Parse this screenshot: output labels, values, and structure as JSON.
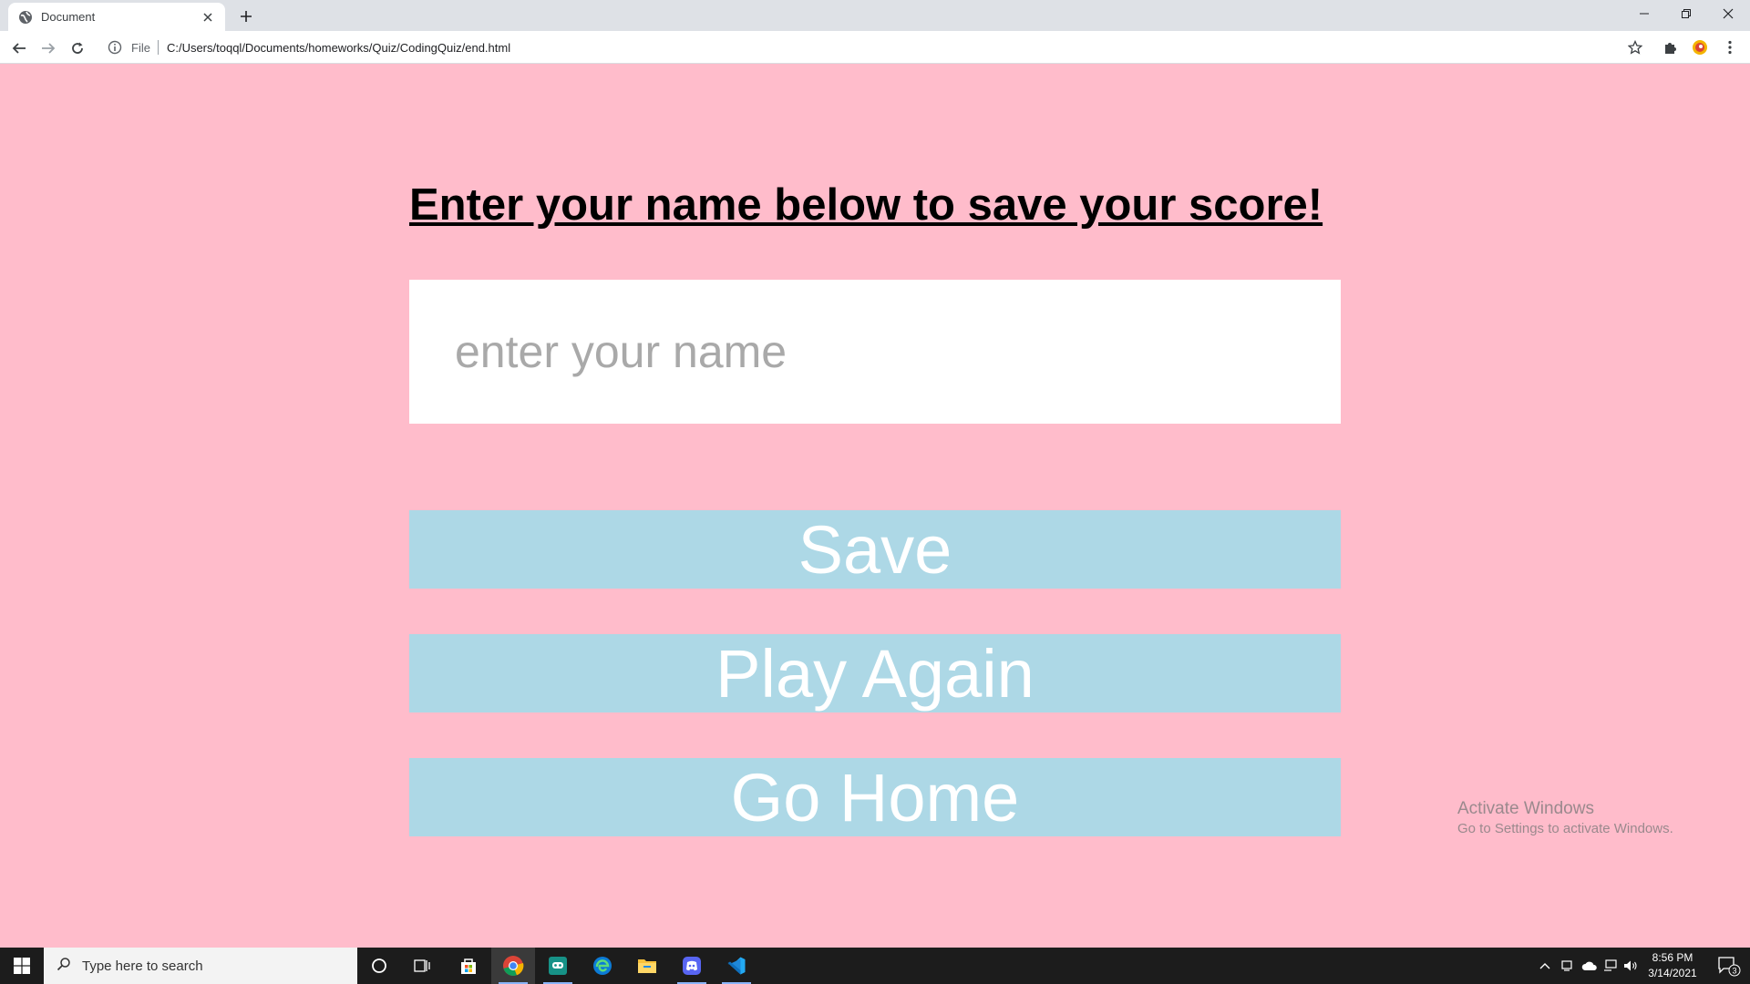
{
  "browser": {
    "tab_title": "Document",
    "address_scheme": "File",
    "address_url": "C:/Users/toqql/Documents/homeworks/Quiz/CodingQuiz/end.html"
  },
  "page": {
    "heading": "Enter your name below to save your score!",
    "name_placeholder": "enter your name",
    "name_value": "",
    "save_label": "Save",
    "play_again_label": "Play Again",
    "go_home_label": "Go Home",
    "watermark_title": "Activate Windows",
    "watermark_subtitle": "Go to Settings to activate Windows."
  },
  "taskbar": {
    "search_placeholder": "Type here to search",
    "time": "8:56 PM",
    "date": "3/14/2021",
    "notification_count": "3"
  },
  "colors": {
    "page_background": "#ffbccb",
    "button_background": "#add8e6",
    "button_text": "#ffffff"
  }
}
